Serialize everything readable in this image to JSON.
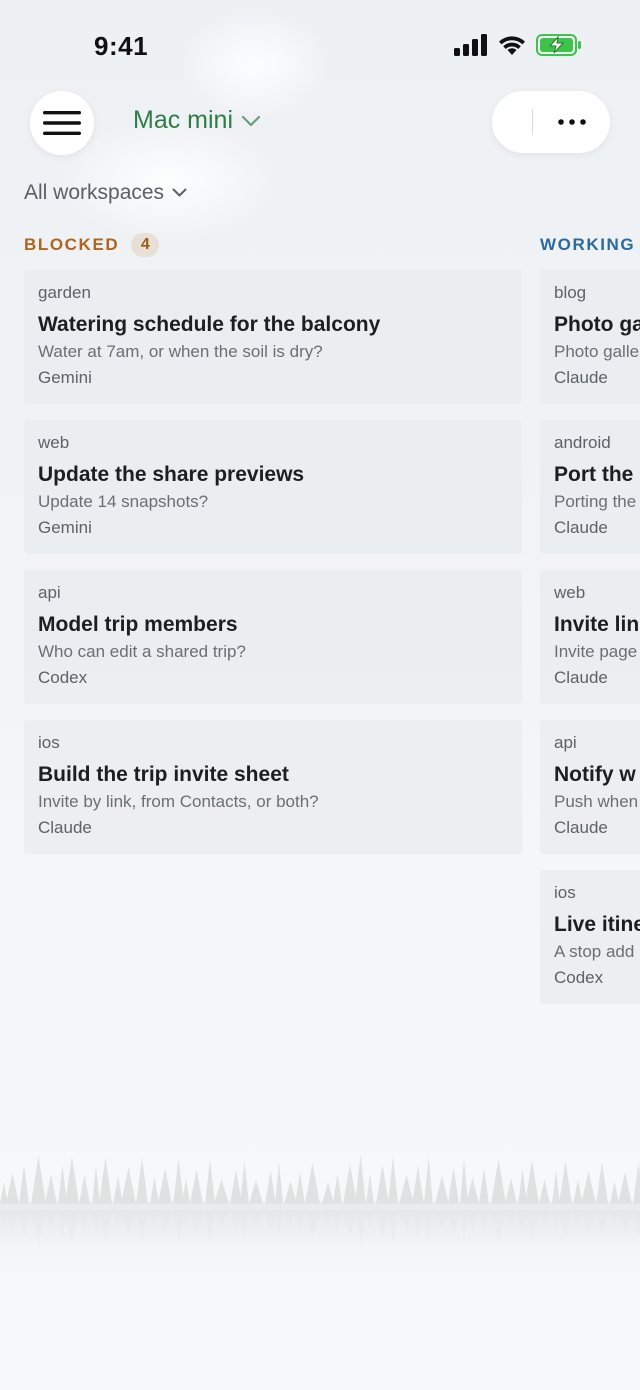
{
  "status_bar": {
    "time": "9:41",
    "icons": [
      "cellular-signal-icon",
      "wifi-icon",
      "battery-charging-icon"
    ]
  },
  "header": {
    "menu_icon": "hamburger-menu-icon",
    "device_name": "Mac mini",
    "more_icon": "ellipsis-icon"
  },
  "filter": {
    "label": "All workspaces"
  },
  "colors": {
    "accent_green": "#2e7d46",
    "blocked": "#b0641c",
    "working": "#2a6a9e"
  },
  "columns": [
    {
      "title": "BLOCKED",
      "count": "4",
      "cards": [
        {
          "workspace": "garden",
          "title": "Watering schedule for the balcony",
          "question": "Water at 7am, or when the soil is dry?",
          "agent": "Gemini"
        },
        {
          "workspace": "web",
          "title": "Update the share previews",
          "question": "Update 14 snapshots?",
          "agent": "Gemini"
        },
        {
          "workspace": "api",
          "title": "Model trip members",
          "question": "Who can edit a shared trip?",
          "agent": "Codex"
        },
        {
          "workspace": "ios",
          "title": "Build the trip invite sheet",
          "question": "Invite by link, from Contacts, or both?",
          "agent": "Claude"
        }
      ]
    },
    {
      "title": "WORKING",
      "cards": [
        {
          "workspace": "blog",
          "title": "Photo ga",
          "question": "Photo galle",
          "agent": "Claude"
        },
        {
          "workspace": "android",
          "title": "Port the",
          "question": "Porting the",
          "agent": "Claude"
        },
        {
          "workspace": "web",
          "title": "Invite lin",
          "question": "Invite page",
          "agent": "Claude"
        },
        {
          "workspace": "api",
          "title": "Notify w",
          "question": "Push when",
          "agent": "Claude"
        },
        {
          "workspace": "ios",
          "title": "Live itine",
          "question": "A stop add",
          "agent": "Codex"
        }
      ]
    }
  ]
}
